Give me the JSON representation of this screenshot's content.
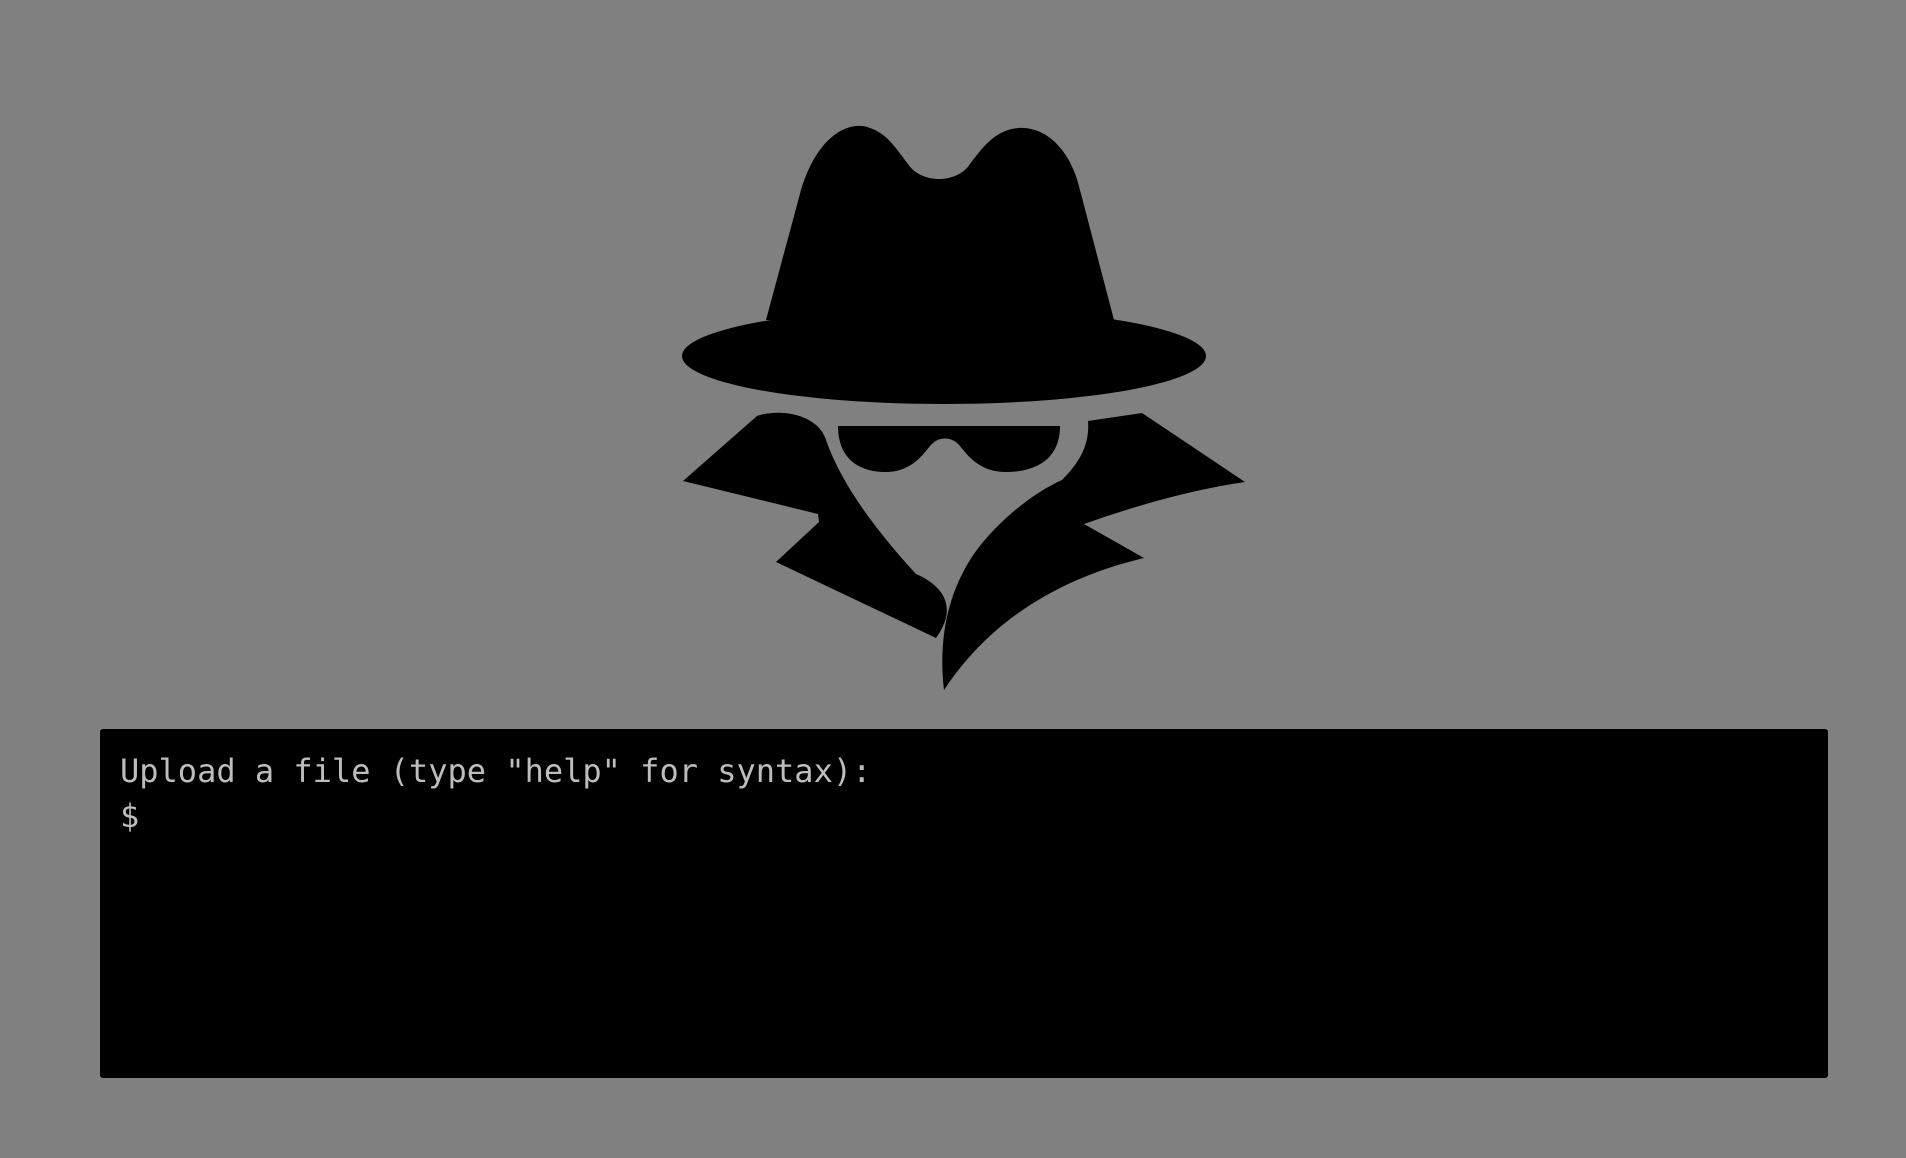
{
  "page": {
    "background_color": "#808080"
  },
  "logo": {
    "icon": "spy-icon",
    "color": "#000000"
  },
  "terminal": {
    "background_color": "#000000",
    "text_color": "#bdbdbd",
    "instruction": "Upload a file (type \"help\" for syntax):",
    "prompt_symbol": "$",
    "input_value": ""
  }
}
